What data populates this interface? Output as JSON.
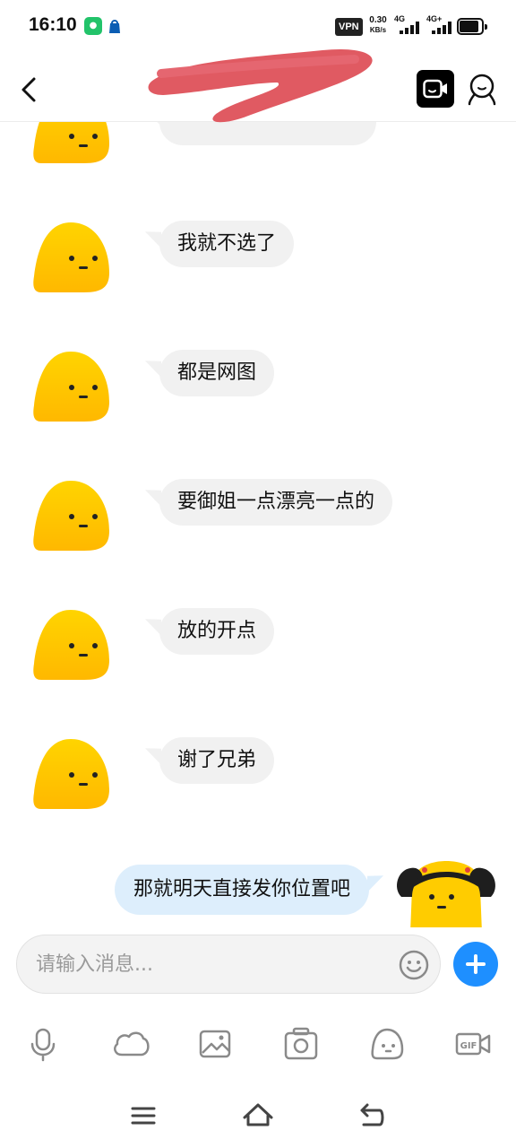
{
  "status_bar": {
    "time": "16:10",
    "vpn": "VPN",
    "speed_value": "0.30",
    "speed_unit": "KB/s",
    "signal1_label": "4G",
    "signal2_label": "4G+"
  },
  "header": {
    "icons": [
      "back-arrow-icon",
      "video-call-icon",
      "profile-icon"
    ]
  },
  "messages": [
    {
      "side": "left",
      "text": ""
    },
    {
      "side": "left",
      "text": "我就不选了"
    },
    {
      "side": "left",
      "text": "都是网图"
    },
    {
      "side": "left",
      "text": "要御姐一点漂亮一点的"
    },
    {
      "side": "left",
      "text": "放的开点"
    },
    {
      "side": "left",
      "text": "谢了兄弟"
    },
    {
      "side": "right",
      "text": "那就明天直接发你位置吧"
    }
  ],
  "input": {
    "placeholder": "请输入消息..."
  },
  "toolbar": {
    "icons": [
      "microphone-icon",
      "cloud-icon",
      "image-icon",
      "camera-icon",
      "sticker-icon",
      "gif-icon"
    ]
  },
  "colors": {
    "accent": "#1e8fff",
    "bubble_in": "#f1f1f1",
    "bubble_out": "#ddeefc",
    "avatar_yellow": "#ffcc00",
    "redaction": "#e05a62"
  }
}
